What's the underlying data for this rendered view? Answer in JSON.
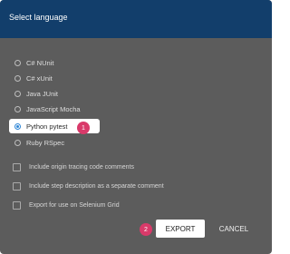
{
  "dialog": {
    "title": "Select language",
    "languages": [
      {
        "label": "C# NUnit",
        "selected": false
      },
      {
        "label": "C# xUnit",
        "selected": false
      },
      {
        "label": "Java JUnit",
        "selected": false
      },
      {
        "label": "JavaScript Mocha",
        "selected": false
      },
      {
        "label": "Python pytest",
        "selected": true
      },
      {
        "label": "Ruby RSpec",
        "selected": false
      }
    ],
    "options": [
      {
        "label": "Include origin tracing code comments",
        "checked": false
      },
      {
        "label": "Include step description as a separate comment",
        "checked": false
      },
      {
        "label": "Export for use on Selenium Grid",
        "checked": false
      }
    ],
    "export_label": "EXPORT",
    "cancel_label": "CANCEL",
    "badges": {
      "step1": "1",
      "step2": "2"
    }
  },
  "colors": {
    "header": "#123e6b",
    "dialog_bg": "#5c5c5c",
    "badge": "#d93a6a",
    "radio_accent": "#2f86d6"
  }
}
